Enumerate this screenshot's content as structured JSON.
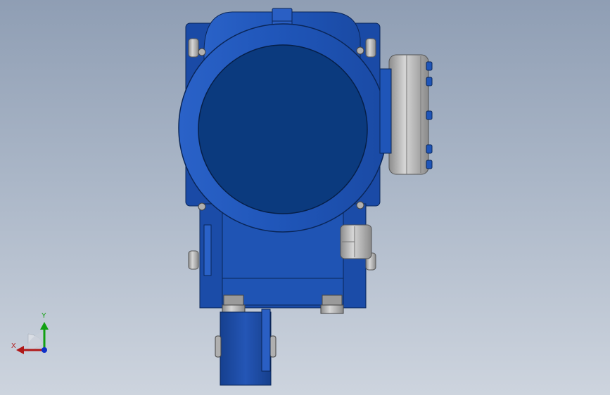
{
  "viewport": {
    "background_top": "#8f9eb4",
    "background_bottom": "#cdd4de"
  },
  "model": {
    "body_color": "#1f55b8",
    "body_dark": "#0d3a8a",
    "cover_color": "#0b3a7e",
    "metal_color": "#b9b9b9"
  },
  "triad": {
    "x_label": "X",
    "y_label": "Y",
    "x_color": "#b01818",
    "y_color": "#12a012",
    "z_color": "#1030c8"
  }
}
